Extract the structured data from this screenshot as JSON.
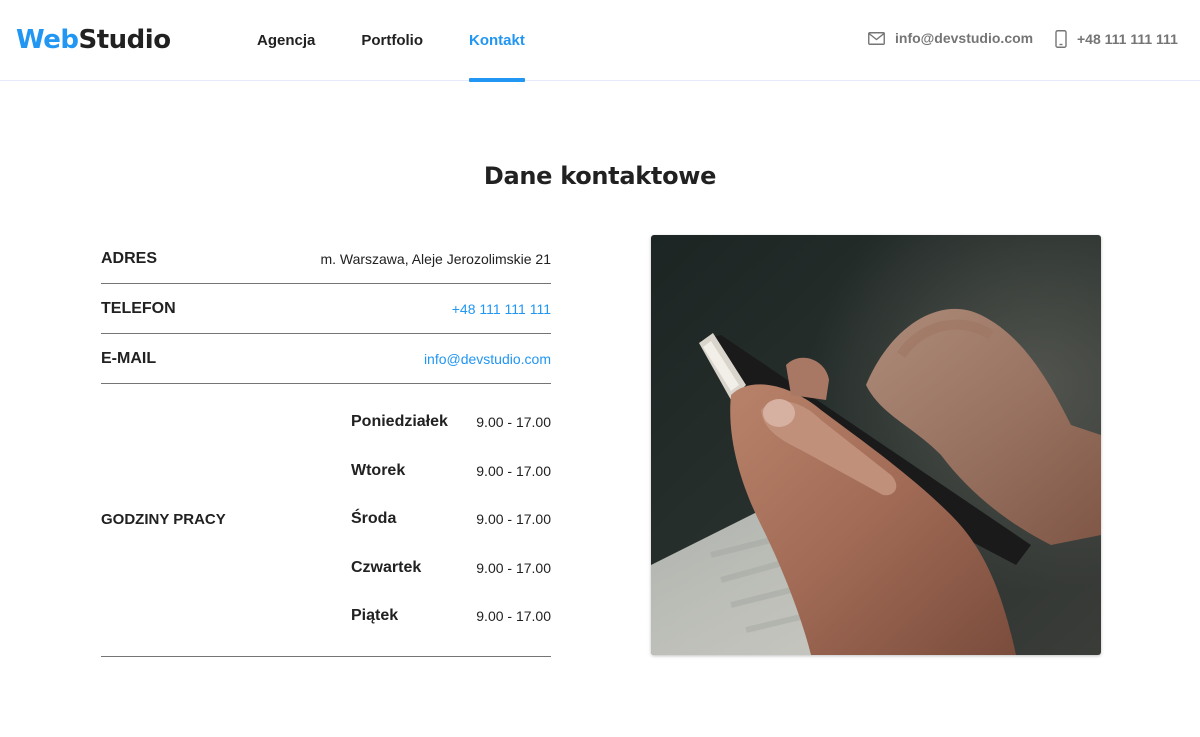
{
  "header": {
    "logo": {
      "part1": "Web",
      "part2": "Studio"
    },
    "nav": [
      {
        "label": "Agencja",
        "active": false
      },
      {
        "label": "Portfolio",
        "active": false
      },
      {
        "label": "Kontakt",
        "active": true
      }
    ],
    "email": {
      "icon": "envelope-icon",
      "text": "info@devstudio.com"
    },
    "phone": {
      "icon": "smartphone-icon",
      "text": "+48 111 111 111"
    }
  },
  "section": {
    "title": "Dane kontaktowe",
    "address": {
      "label": "ADRES",
      "value": "m. Warszawa, Aleje Jerozolimskie 21"
    },
    "phone": {
      "label": "TELEFON",
      "value": "+48 111 111 111"
    },
    "email": {
      "label": "E-MAIL",
      "value": "info@devstudio.com"
    },
    "hours": {
      "label": "GODZINY PRACY",
      "days": [
        {
          "day": "Poniedziałek",
          "time": "9.00 - 17.00"
        },
        {
          "day": "Wtorek",
          "time": "9.00 - 17.00"
        },
        {
          "day": "Środa",
          "time": "9.00 - 17.00"
        },
        {
          "day": "Czwartek",
          "time": "9.00 - 17.00"
        },
        {
          "day": "Piątek",
          "time": "9.00 - 17.00"
        }
      ]
    }
  },
  "colors": {
    "accent": "#2196f3",
    "text": "#212121",
    "muted": "#757575"
  }
}
